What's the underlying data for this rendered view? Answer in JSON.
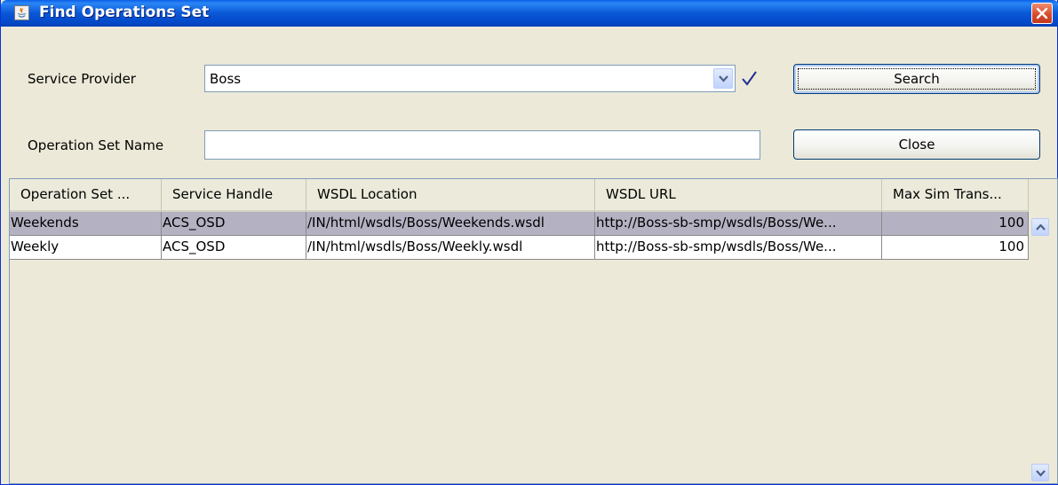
{
  "window": {
    "title": "Find Operations Set",
    "icon": "java-cup-icon"
  },
  "form": {
    "service_provider_label": "Service Provider",
    "service_provider_value": "Boss",
    "operation_set_name_label": "Operation Set Name",
    "operation_set_name_value": "",
    "search_label": "Search",
    "close_label": "Close"
  },
  "table": {
    "columns": [
      "Operation Set ...",
      "Service Handle",
      "WSDL Location",
      "WSDL URL",
      "Max Sim Trans..."
    ],
    "rows": [
      {
        "name": "Weekends",
        "handle": "ACS_OSD",
        "location": "/IN/html/wsdls/Boss/Weekends.wsdl",
        "url": "http://Boss-sb-smp/wsdls/Boss/We...",
        "max": "100",
        "selected": true
      },
      {
        "name": "Weekly",
        "handle": "ACS_OSD",
        "location": "/IN/html/wsdls/Boss/Weekly.wsdl",
        "url": "http://Boss-sb-smp/wsdls/Boss/We...",
        "max": "100",
        "selected": false
      }
    ]
  },
  "colors": {
    "titlebar": "#0a57d6",
    "window_bg": "#ece9d8",
    "selected_row": "#b4b2c2",
    "check": "#1f2f8f"
  }
}
